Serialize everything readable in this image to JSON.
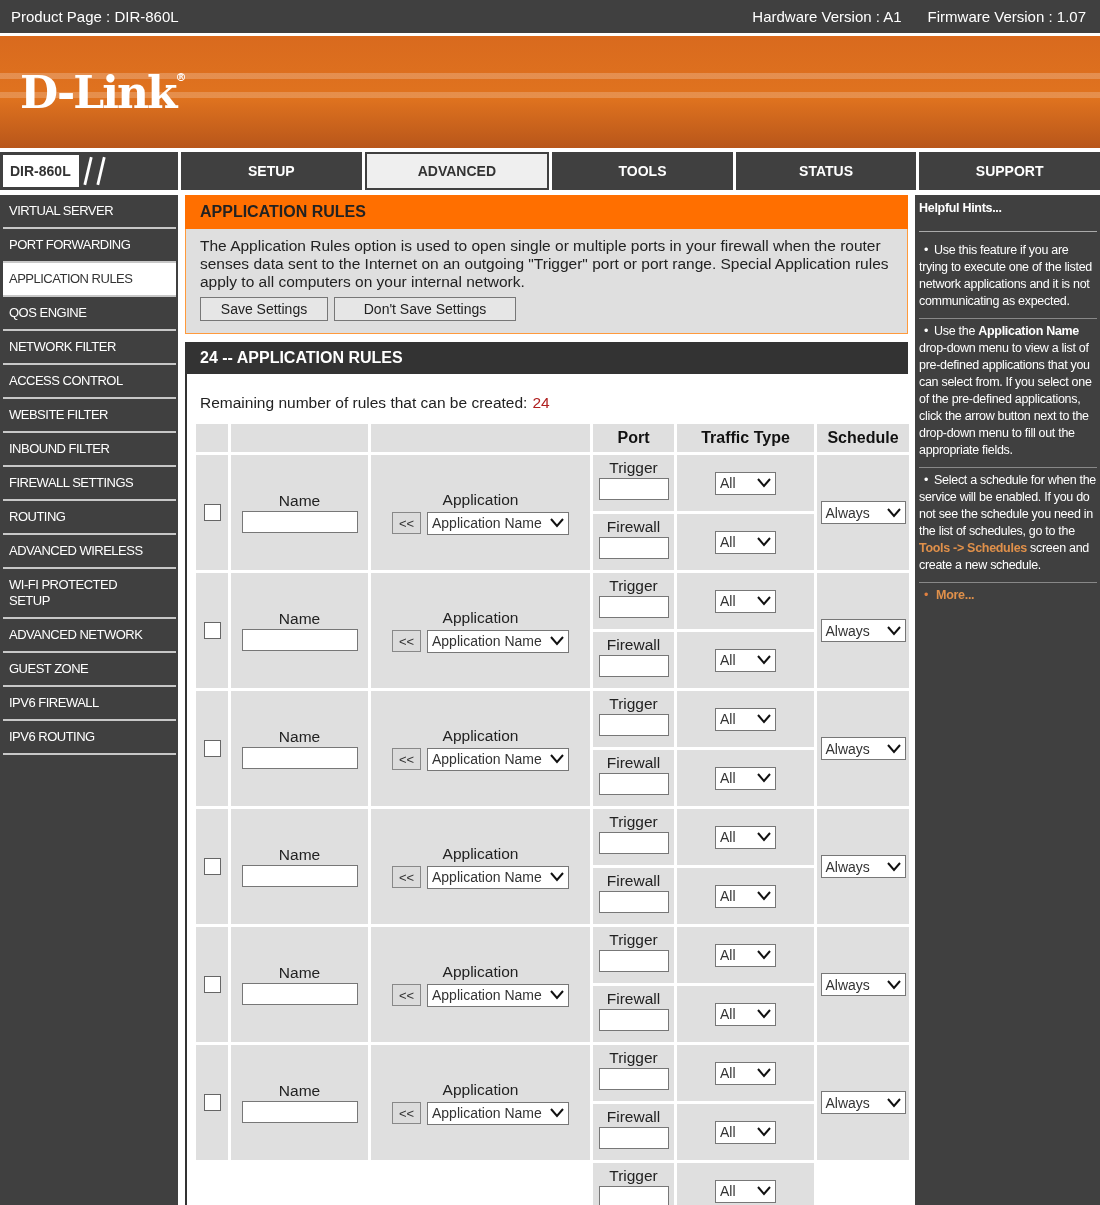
{
  "top_bar": {
    "product": "Product Page : DIR-860L",
    "hardware": "Hardware Version : A1",
    "firmware": "Firmware Version : 1.07"
  },
  "logo": {
    "text": "D-Link",
    "mark": "®"
  },
  "model": "DIR-860L",
  "tabs": [
    {
      "label": "SETUP",
      "selected": false
    },
    {
      "label": "ADVANCED",
      "selected": true
    },
    {
      "label": "TOOLS",
      "selected": false
    },
    {
      "label": "STATUS",
      "selected": false
    },
    {
      "label": "SUPPORT",
      "selected": false
    }
  ],
  "sidebar": {
    "items": [
      {
        "label": "VIRTUAL SERVER",
        "selected": false
      },
      {
        "label": "PORT FORWARDING",
        "selected": false
      },
      {
        "label": "APPLICATION RULES",
        "selected": true
      },
      {
        "label": "QOS ENGINE",
        "selected": false
      },
      {
        "label": "NETWORK FILTER",
        "selected": false
      },
      {
        "label": "ACCESS CONTROL",
        "selected": false
      },
      {
        "label": "WEBSITE FILTER",
        "selected": false
      },
      {
        "label": "INBOUND FILTER",
        "selected": false
      },
      {
        "label": "FIREWALL SETTINGS",
        "selected": false
      },
      {
        "label": "ROUTING",
        "selected": false
      },
      {
        "label": "ADVANCED WIRELESS",
        "selected": false
      },
      {
        "label": "WI-FI PROTECTED SETUP",
        "selected": false
      },
      {
        "label": "ADVANCED NETWORK",
        "selected": false
      },
      {
        "label": "GUEST ZONE",
        "selected": false
      },
      {
        "label": "IPV6 FIREWALL",
        "selected": false
      },
      {
        "label": "IPV6 ROUTING",
        "selected": false
      }
    ]
  },
  "intro": {
    "title": "APPLICATION RULES",
    "description": "The Application Rules option is used to open single or multiple ports in your firewall when the router senses data sent to the Internet on an outgoing \"Trigger\" port or port range. Special Application rules apply to all computers on your internal network.",
    "buttons": [
      "Save Settings",
      "Don't Save Settings"
    ]
  },
  "rules": {
    "title": "24 -- APPLICATION RULES",
    "remaining_label": "Remaining number of rules that can be created:",
    "remaining_count": "24",
    "columns": [
      "Port",
      "Traffic Type",
      "Schedule"
    ],
    "rows": [
      {
        "checked": false,
        "name_label": "Name",
        "app_label": "Application",
        "copy_button": "<<",
        "app_select": "Application Name",
        "trigger_label": "Trigger",
        "trigger_type": "All",
        "firewall_label": "Firewall",
        "firewall_type": "All",
        "schedule": "Always"
      },
      {
        "checked": false,
        "name_label": "Name",
        "app_label": "Application",
        "copy_button": "<<",
        "app_select": "Application Name",
        "trigger_label": "Trigger",
        "trigger_type": "All",
        "firewall_label": "Firewall",
        "firewall_type": "All",
        "schedule": "Always"
      },
      {
        "checked": false,
        "name_label": "Name",
        "app_label": "Application",
        "copy_button": "<<",
        "app_select": "Application Name",
        "trigger_label": "Trigger",
        "trigger_type": "All",
        "firewall_label": "Firewall",
        "firewall_type": "All",
        "schedule": "Always"
      },
      {
        "checked": false,
        "name_label": "Name",
        "app_label": "Application",
        "copy_button": "<<",
        "app_select": "Application Name",
        "trigger_label": "Trigger",
        "trigger_type": "All",
        "firewall_label": "Firewall",
        "firewall_type": "All",
        "schedule": "Always"
      },
      {
        "checked": false,
        "name_label": "Name",
        "app_label": "Application",
        "copy_button": "<<",
        "app_select": "Application Name",
        "trigger_label": "Trigger",
        "trigger_type": "All",
        "firewall_label": "Firewall",
        "firewall_type": "All",
        "schedule": "Always"
      },
      {
        "checked": false,
        "name_label": "Name",
        "app_label": "Application",
        "copy_button": "<<",
        "app_select": "Application Name",
        "trigger_label": "Trigger",
        "trigger_type": "All",
        "firewall_label": "Firewall",
        "firewall_type": "All",
        "schedule": "Always"
      },
      {
        "trigger_label": "Trigger",
        "trigger_type": "All"
      }
    ]
  },
  "hints": {
    "title": "Helpful Hints...",
    "items": [
      {
        "bullet": "•",
        "text": "Use this feature if you are trying to execute one of the listed network applications and it is not communicating as expected."
      },
      {
        "bullet": "•",
        "text": "Use the **Application Name** drop-down menu to view a list of pre-defined applications that you can select from. If you select one of the pre-defined applications, click the arrow button next to the drop-down menu to fill out the appropriate fields."
      },
      {
        "bullet": "•",
        "text": "Select a schedule for when the service will be enabled. If you do not see the schedule you need in the list of schedules, go to the",
        "link": "Tools -> Schedules",
        "after": "screen and create a new schedule."
      }
    ],
    "more": {
      "bullet": "•",
      "label": "More..."
    }
  }
}
